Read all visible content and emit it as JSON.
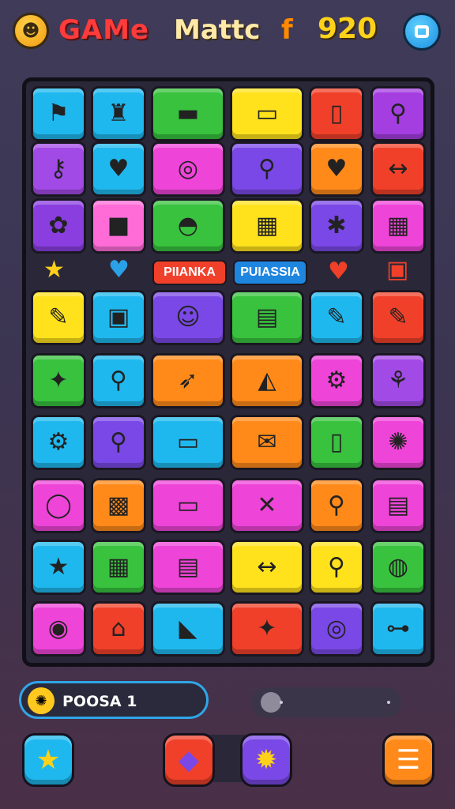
{
  "header": {
    "logo_glyph": "☻",
    "title_part1": "GAMe",
    "title_part2": "Mattc",
    "title_part3": "f",
    "score": "920",
    "menu_icon": "chat-icon"
  },
  "board": {
    "rows": [
      [
        {
          "color": "#1fb8ee",
          "glyph": "⚑"
        },
        {
          "color": "#1fb8ee",
          "glyph": "♜"
        },
        {
          "color": "#38c23e",
          "glyph": "▬"
        },
        {
          "color": "#ffe21c",
          "glyph": "▭"
        },
        {
          "color": "#f0402a",
          "glyph": "▯"
        },
        {
          "color": "#a43ee0",
          "glyph": "⚲"
        }
      ],
      [
        {
          "color": "#a24ae6",
          "glyph": "⚷"
        },
        {
          "color": "#1fb8ee",
          "glyph": "♥"
        },
        {
          "color": "#ee44d8",
          "glyph": "◎"
        },
        {
          "color": "#7a48e6",
          "glyph": "⚲"
        },
        {
          "color": "#ff8a1a",
          "glyph": "♥"
        },
        {
          "color": "#f0402a",
          "glyph": "↔"
        }
      ],
      [
        {
          "color": "#8a3ee0",
          "glyph": "✿"
        },
        {
          "color": "#ff6cd8",
          "glyph": "■"
        },
        {
          "color": "#38c23e",
          "glyph": "◓"
        },
        {
          "color": "#ffe21c",
          "glyph": "▦"
        },
        {
          "color": "#7a48e6",
          "glyph": "✱"
        },
        {
          "color": "#ee44d8",
          "glyph": "▦"
        }
      ],
      [
        {
          "color": "#ffe21c",
          "glyph": "✎"
        },
        {
          "color": "#1fb8ee",
          "glyph": "▣"
        },
        {
          "color": "#7a48e6",
          "glyph": "☺"
        },
        {
          "color": "#38c23e",
          "glyph": "▤"
        },
        {
          "color": "#1fb8ee",
          "glyph": "✎"
        },
        {
          "color": "#f0402a",
          "glyph": "✎"
        }
      ],
      [
        {
          "color": "#38c23e",
          "glyph": "✦"
        },
        {
          "color": "#1fb8ee",
          "glyph": "⚲"
        },
        {
          "color": "#ff8a1a",
          "glyph": "➶"
        },
        {
          "color": "#ff8a1a",
          "glyph": "◭"
        },
        {
          "color": "#ee44d8",
          "glyph": "⚙"
        },
        {
          "color": "#a24ae6",
          "glyph": "⚘"
        }
      ],
      [
        {
          "color": "#1fb8ee",
          "glyph": "⚙"
        },
        {
          "color": "#7a48e6",
          "glyph": "⚲"
        },
        {
          "color": "#1fb8ee",
          "glyph": "▭"
        },
        {
          "color": "#ff8a1a",
          "glyph": "✉"
        },
        {
          "color": "#38c23e",
          "glyph": "▯"
        },
        {
          "color": "#ee44d8",
          "glyph": "✺"
        }
      ],
      [
        {
          "color": "#ee44d8",
          "glyph": "◯"
        },
        {
          "color": "#ff8a1a",
          "glyph": "▩"
        },
        {
          "color": "#ee44d8",
          "glyph": "▭"
        },
        {
          "color": "#ee44d8",
          "glyph": "✕"
        },
        {
          "color": "#ff8a1a",
          "glyph": "⚲"
        },
        {
          "color": "#ee44d8",
          "glyph": "▤"
        }
      ],
      [
        {
          "color": "#1fb8ee",
          "glyph": "★"
        },
        {
          "color": "#38c23e",
          "glyph": "▦"
        },
        {
          "color": "#ee44d8",
          "glyph": "▤"
        },
        {
          "color": "#ffe21c",
          "glyph": "↔"
        },
        {
          "color": "#ffe21c",
          "glyph": "⚲"
        },
        {
          "color": "#38c23e",
          "glyph": "◍"
        }
      ],
      [
        {
          "color": "#ee44d8",
          "glyph": "◉"
        },
        {
          "color": "#f0402a",
          "glyph": "⌂"
        },
        {
          "color": "#1fb8ee",
          "glyph": "◣"
        },
        {
          "color": "#f0402a",
          "glyph": "✦"
        },
        {
          "color": "#7a48e6",
          "glyph": "◎"
        },
        {
          "color": "#1fb8ee",
          "glyph": "⊶"
        }
      ]
    ],
    "special_row": {
      "star_glyph": "★",
      "heart_blue_glyph": "♥",
      "pill1": "PIIANKA",
      "pill2": "PUIASSIA",
      "heart_red_glyph": "♥",
      "cube_glyph": "▣"
    }
  },
  "combo": {
    "glyph": "✺",
    "text": "POOSA 1"
  },
  "slider": {
    "value": 0.05
  },
  "bottom_buttons": {
    "star_glyph": "★",
    "bag_glyph": "◆",
    "gear_glyph": "✹",
    "menu_glyph": "☰"
  }
}
